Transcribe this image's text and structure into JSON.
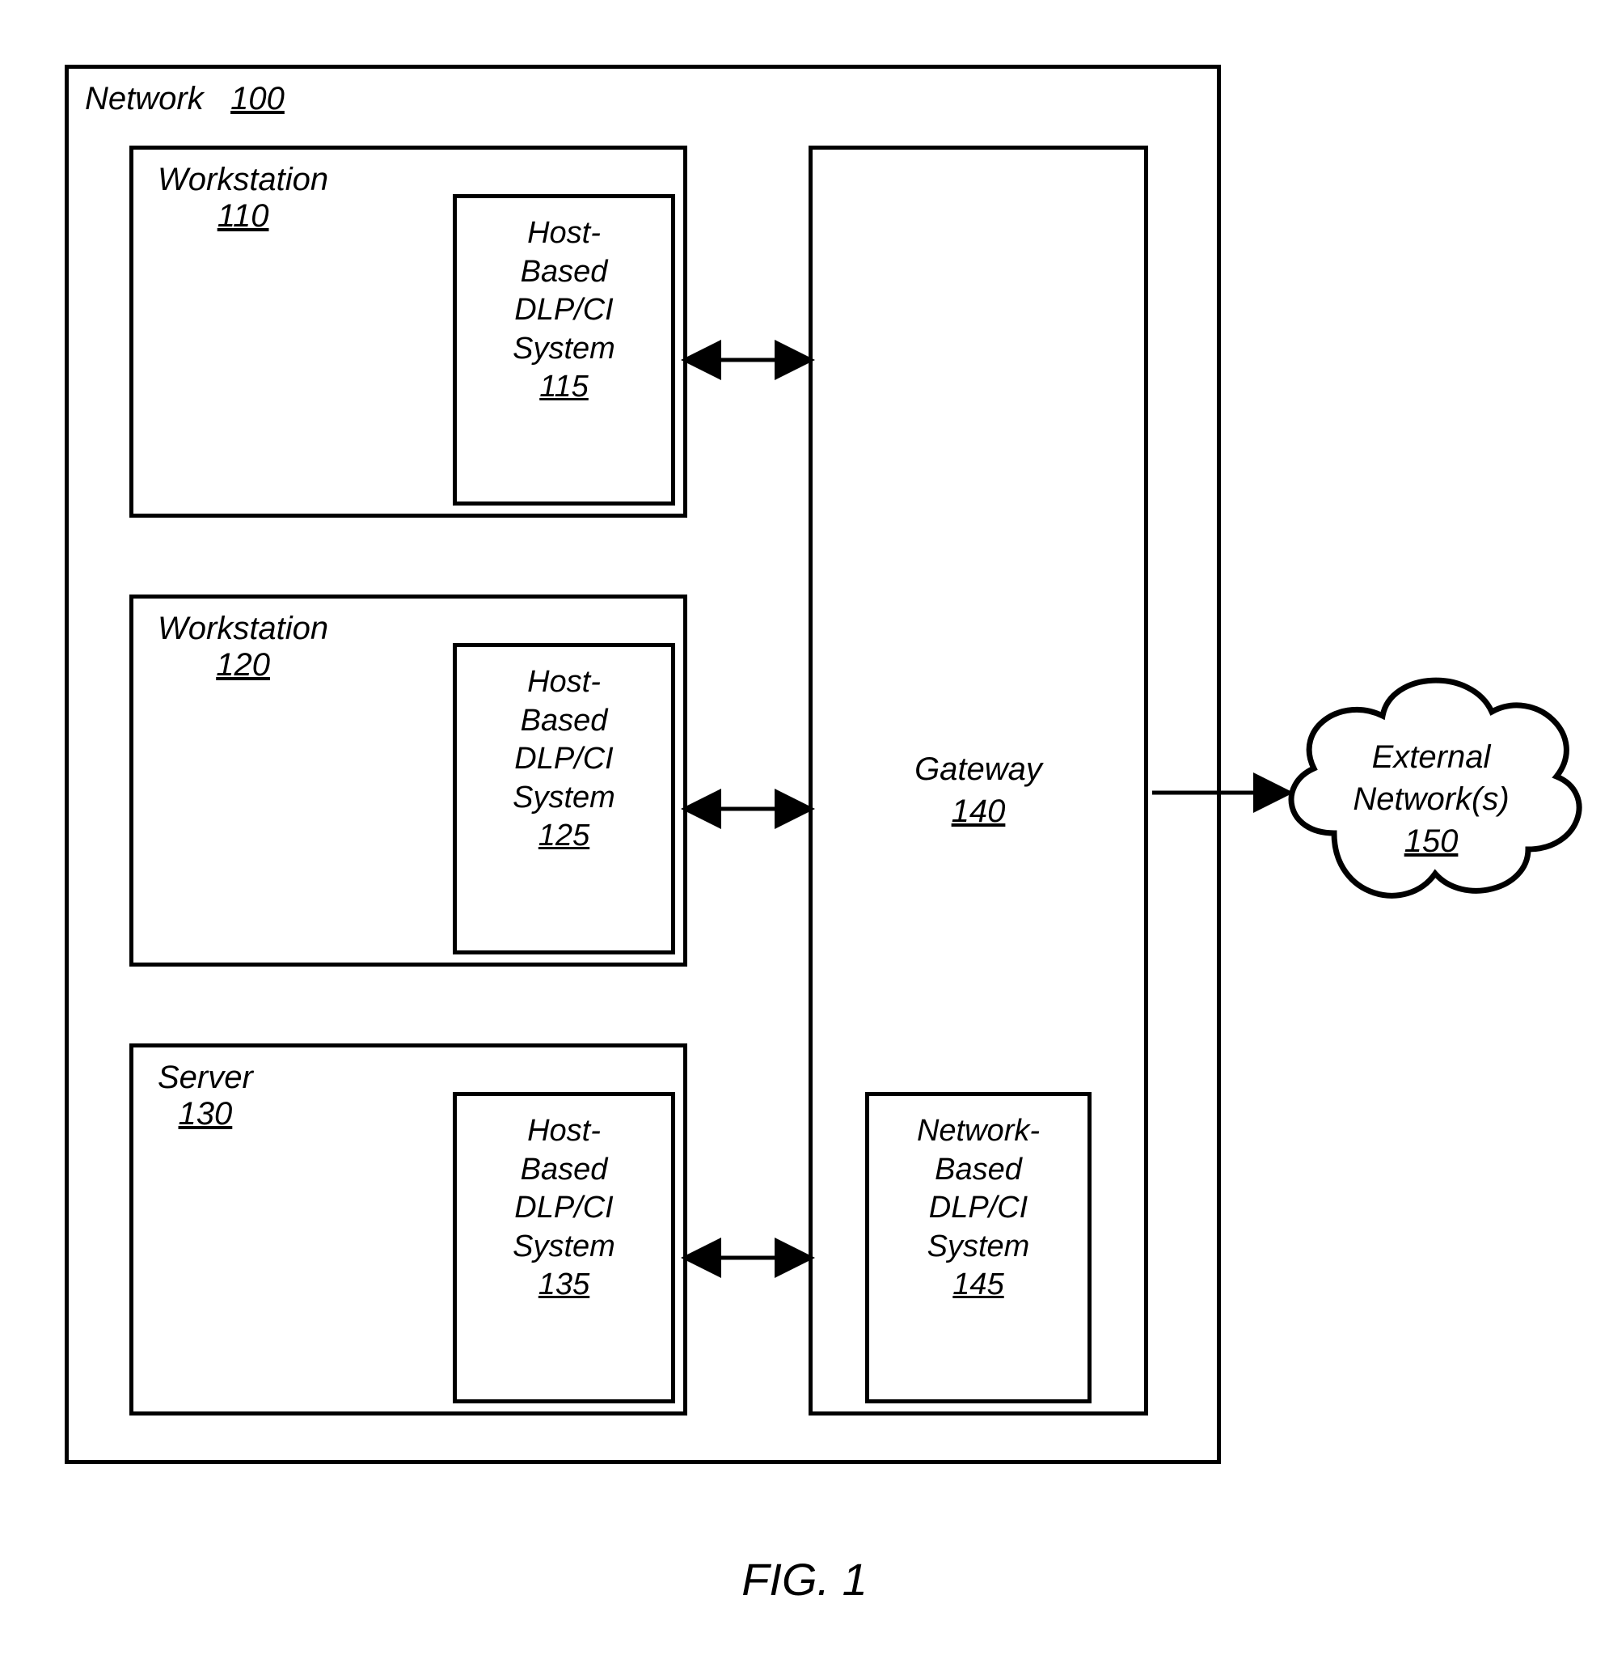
{
  "network": {
    "title": "Network",
    "num": "100"
  },
  "hosts": [
    {
      "title": "Workstation",
      "num": "110",
      "system_label": "Host-Based DLP/CI System",
      "system_num": "115"
    },
    {
      "title": "Workstation",
      "num": "120",
      "system_label": "Host-Based DLP/CI System",
      "system_num": "125"
    },
    {
      "title": "Server",
      "num": "130",
      "system_label": "Host-Based DLP/CI System",
      "system_num": "135"
    }
  ],
  "gateway": {
    "title": "Gateway",
    "num": "140",
    "system_label": "Network-Based DLP/CI System",
    "system_num": "145"
  },
  "external": {
    "title": "External Network(s)",
    "num": "150"
  },
  "caption": "FIG. 1"
}
